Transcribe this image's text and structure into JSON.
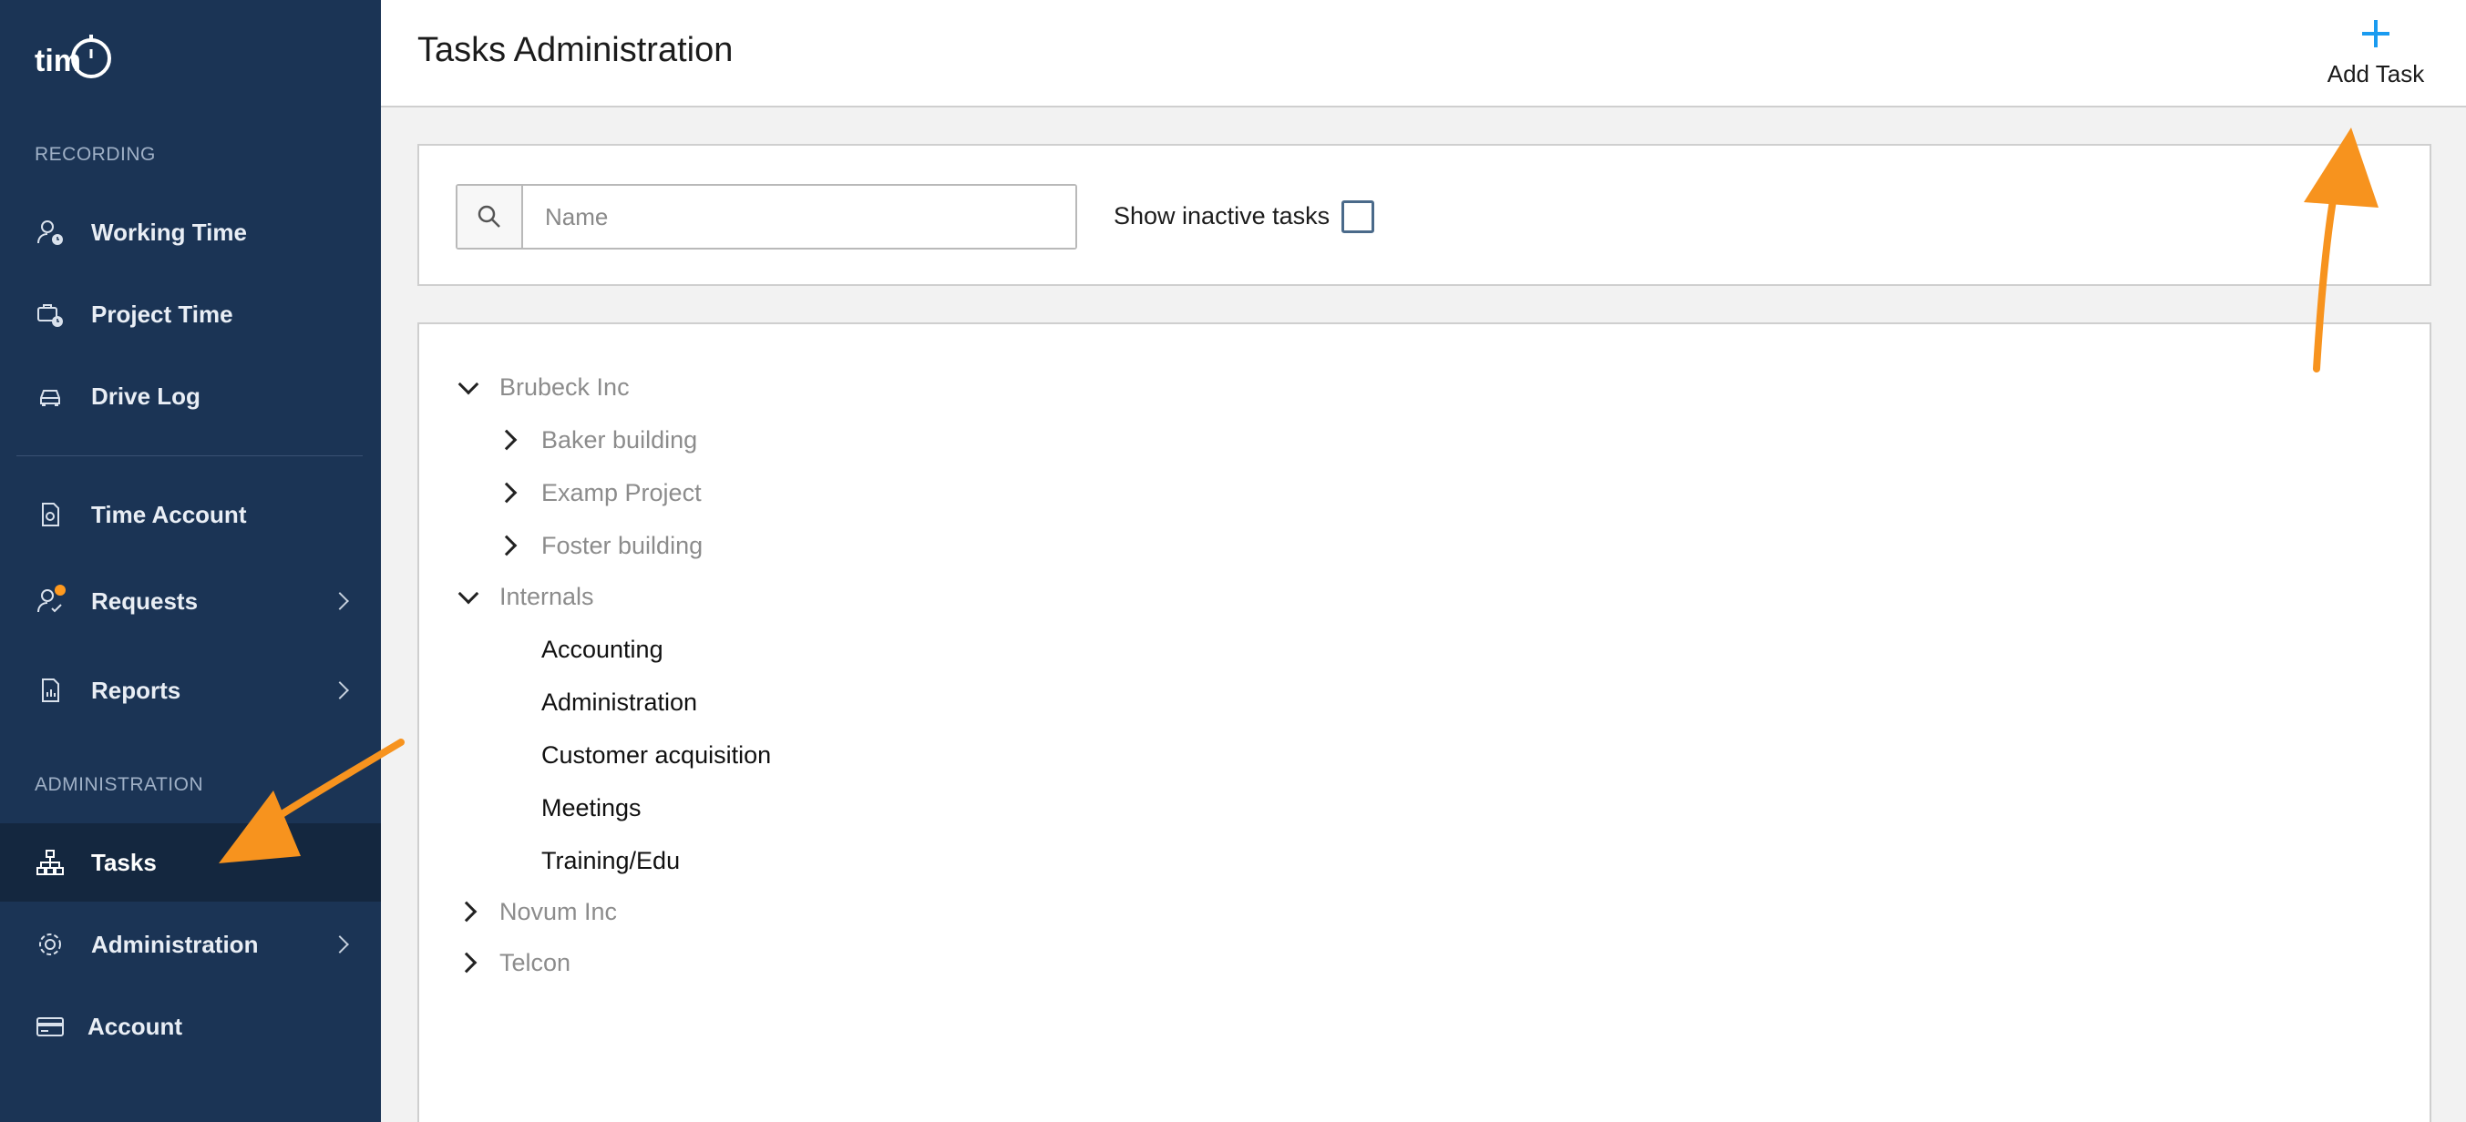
{
  "app": {
    "logo_text": "timr"
  },
  "sidebar": {
    "sections": [
      {
        "label": "RECORDING"
      },
      {
        "label": "ADMINISTRATION"
      }
    ],
    "items": [
      {
        "label": "Working Time",
        "icon": "user-clock-icon"
      },
      {
        "label": "Project Time",
        "icon": "briefcase-clock-icon"
      },
      {
        "label": "Drive Log",
        "icon": "car-icon"
      },
      {
        "label": "Time Account",
        "icon": "document-clock-icon"
      },
      {
        "label": "Requests",
        "icon": "user-check-icon",
        "has_badge": true,
        "has_submenu": true
      },
      {
        "label": "Reports",
        "icon": "report-chart-icon",
        "has_submenu": true
      },
      {
        "label": "Tasks",
        "icon": "hierarchy-icon",
        "active": true
      },
      {
        "label": "Administration",
        "icon": "gear-icon",
        "has_submenu": true
      },
      {
        "label": "Account",
        "icon": "credit-card-icon"
      }
    ]
  },
  "header": {
    "title": "Tasks Administration",
    "add_task_label": "Add Task"
  },
  "filter": {
    "search_placeholder": "Name",
    "search_value": "",
    "show_inactive_label": "Show inactive tasks",
    "show_inactive_checked": false
  },
  "tree": [
    {
      "label": "Brubeck Inc",
      "expanded": true,
      "children": [
        {
          "label": "Baker building",
          "expanded": false
        },
        {
          "label": "Examp Project",
          "expanded": false
        },
        {
          "label": "Foster building",
          "expanded": false
        }
      ]
    },
    {
      "label": "Internals",
      "expanded": true,
      "children": [
        {
          "label": "Accounting"
        },
        {
          "label": "Administration"
        },
        {
          "label": "Customer acquisition"
        },
        {
          "label": "Meetings"
        },
        {
          "label": "Training/Edu"
        }
      ]
    },
    {
      "label": "Novum Inc",
      "expanded": false
    },
    {
      "label": "Telcon",
      "expanded": false
    }
  ],
  "colors": {
    "sidebar_bg": "#1b3455",
    "sidebar_active_bg": "#14273f",
    "accent_blue": "#1a9bf0",
    "annotation_orange": "#f7931e",
    "badge_orange": "#ff9a1f"
  }
}
